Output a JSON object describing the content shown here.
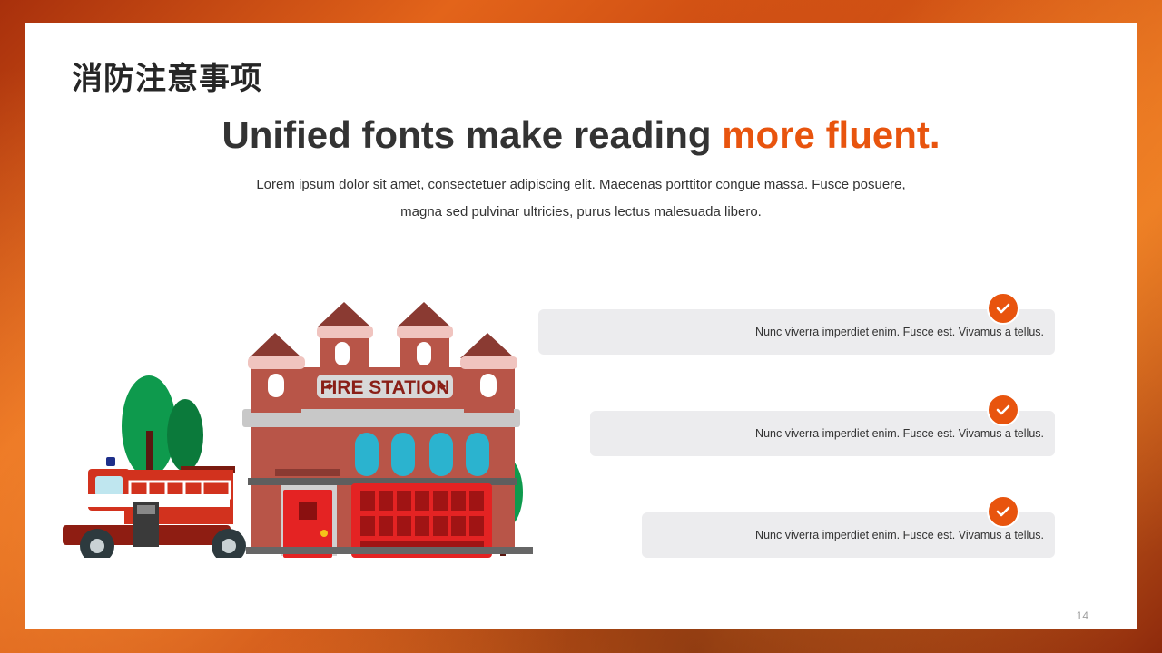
{
  "slide": {
    "title_cn": "消防注意事项",
    "headline_main": "Unified fonts make reading ",
    "headline_accent": "more fluent.",
    "body_line1": "Lorem ipsum dolor sit amet, consectetuer adipiscing elit. Maecenas porttitor congue massa. Fusce posuere,",
    "body_line2": "magna sed pulvinar ultricies, purus lectus malesuada libero.",
    "page_number": "14"
  },
  "illustration": {
    "sign_text": "FIRE STATION",
    "icon": "fire-station-illustration"
  },
  "items": [
    {
      "text": "Nunc  viverra  imperdiet enim. Fusce est. Vivamus  a tellus.",
      "icon": "check-icon"
    },
    {
      "text": "Nunc  viverra  imperdiet enim. Fusce est. Vivamus  a tellus.",
      "icon": "check-icon"
    },
    {
      "text": "Nunc  viverra  imperdiet enim. Fusce est. Vivamus  a tellus.",
      "icon": "check-icon"
    }
  ],
  "colors": {
    "accent": "#e8540e",
    "item_bg": "#ececee",
    "text_dark": "#333333",
    "frame": "#c4420f"
  }
}
